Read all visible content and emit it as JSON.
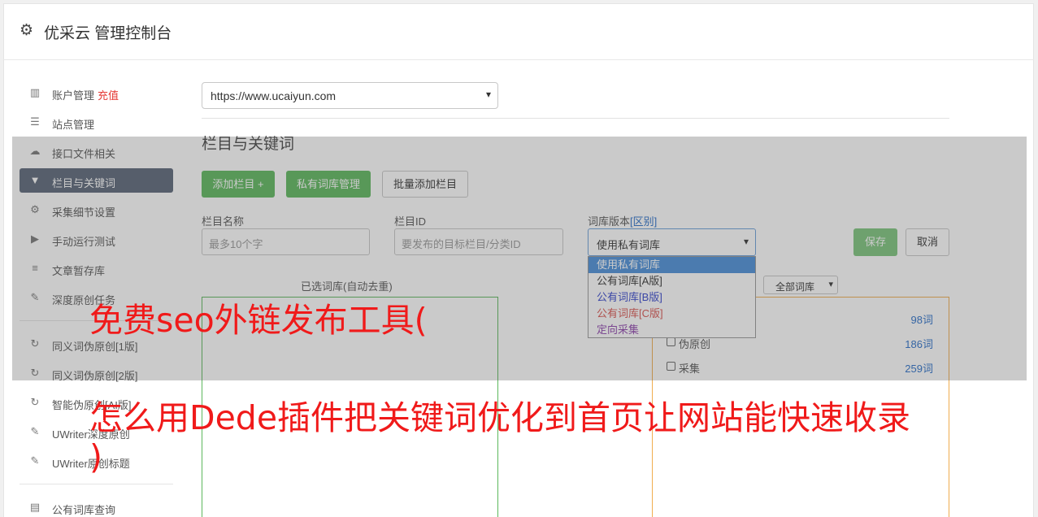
{
  "header": {
    "title": "优采云 管理控制台"
  },
  "sidebar": {
    "items": [
      {
        "label": "账户管理",
        "extra": "充值",
        "icon": "bar-chart-icon"
      },
      {
        "label": "站点管理",
        "icon": "server-icon"
      },
      {
        "label": "接口文件相关",
        "icon": "cloud-upload-icon"
      },
      {
        "label": "栏目与关键词",
        "icon": "filter-icon",
        "active": true
      },
      {
        "label": "采集细节设置",
        "icon": "cogs-icon"
      },
      {
        "label": "手动运行测试",
        "icon": "play-circle-icon"
      },
      {
        "label": "文章暂存库",
        "icon": "database-icon"
      },
      {
        "label": "深度原创任务",
        "icon": "edit-icon"
      },
      {
        "label": "同义词伪原创[1版]",
        "icon": "refresh-icon"
      },
      {
        "label": "同义词伪原创[2版]",
        "icon": "refresh-icon"
      },
      {
        "label": "智能伪原创[AI版]",
        "icon": "refresh-icon"
      },
      {
        "label": "UWriter深度原创",
        "icon": "edit-icon"
      },
      {
        "label": "UWriter原创标题",
        "icon": "edit-icon"
      },
      {
        "label": "公有词库查询",
        "icon": "book-icon"
      }
    ]
  },
  "site_select": {
    "value": "https://www.ucaiyun.com"
  },
  "section_title": "栏目与关键词",
  "buttons": {
    "add_column": "添加栏目 +",
    "private_lib": "私有词库管理",
    "batch_add": "批量添加栏目",
    "save": "保存",
    "cancel": "取消"
  },
  "fields": {
    "name_label": "栏目名称",
    "name_placeholder": "最多10个字",
    "id_label": "栏目ID",
    "id_placeholder": "要发布的目标栏目/分类ID",
    "version_label": "词库版本",
    "version_label_link": "[区别]",
    "version_value": "使用私有词库"
  },
  "dropdown": {
    "options": [
      {
        "label": "使用私有词库",
        "color": "#ffffff",
        "selected": true
      },
      {
        "label": "公有词库[A版]",
        "color": "#333333"
      },
      {
        "label": "公有词库[B版]",
        "color": "#3344cc"
      },
      {
        "label": "公有词库[C版]",
        "color": "#d9534f"
      },
      {
        "label": "定向采集",
        "color": "#8e44ad"
      }
    ]
  },
  "selected_box_caption": "已选词库(自动去重)",
  "library_filter": "全部词库",
  "library_rows": [
    {
      "name": "",
      "count": "98词"
    },
    {
      "name": "伪原创",
      "count": "186词"
    },
    {
      "name": "采集",
      "count": "259词"
    }
  ],
  "watermark": {
    "line1": "免费seo外链发布工具(",
    "line2": "怎么用Dede插件把关键词优化到首页让网站能快速收录",
    "line3": ")"
  }
}
